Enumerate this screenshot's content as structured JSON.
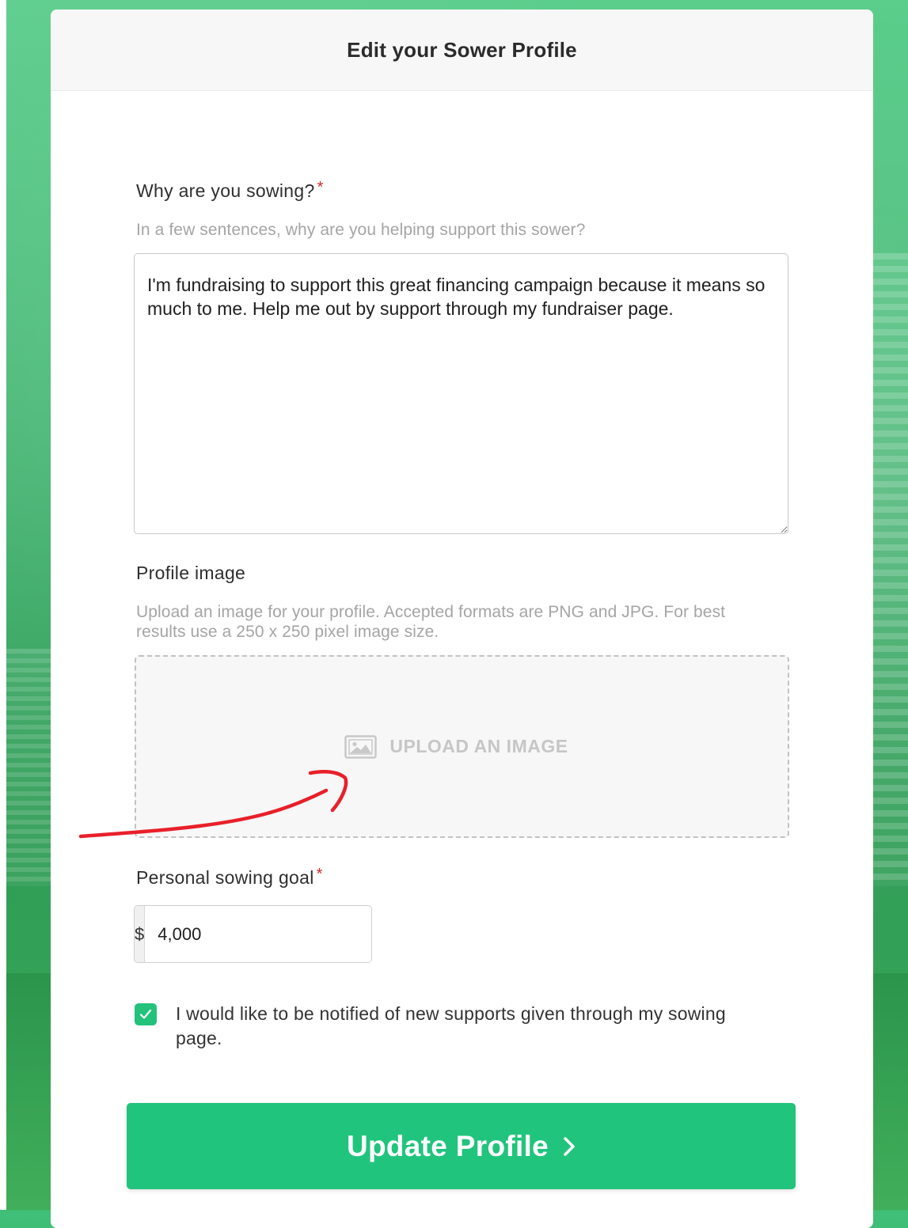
{
  "page": {
    "title": "Edit your Sower Profile"
  },
  "reason": {
    "label": "Why are you sowing?",
    "required_mark": "*",
    "help": "In a few sentences, why are you helping support this sower?",
    "value": "I'm fundraising to support this great financing campaign because it means so much to me. Help me out by support through my fundraiser page."
  },
  "profile_image": {
    "label": "Profile image",
    "help": "Upload an image for your profile. Accepted formats are PNG and JPG. For best results use a 250 x 250 pixel image size.",
    "upload_label": "UPLOAD AN IMAGE",
    "icon": "image-icon"
  },
  "goal": {
    "label": "Personal sowing goal",
    "required_mark": "*",
    "currency": "$",
    "value": "4,000"
  },
  "notify": {
    "checked": true,
    "label": "I would like to be notified of new supports given through my sowing page."
  },
  "submit": {
    "label": "Update Profile",
    "icon": "chevron-right-icon"
  },
  "colors": {
    "accent": "#21c47c",
    "required": "#d9262b",
    "annotation": "#e8202a"
  }
}
